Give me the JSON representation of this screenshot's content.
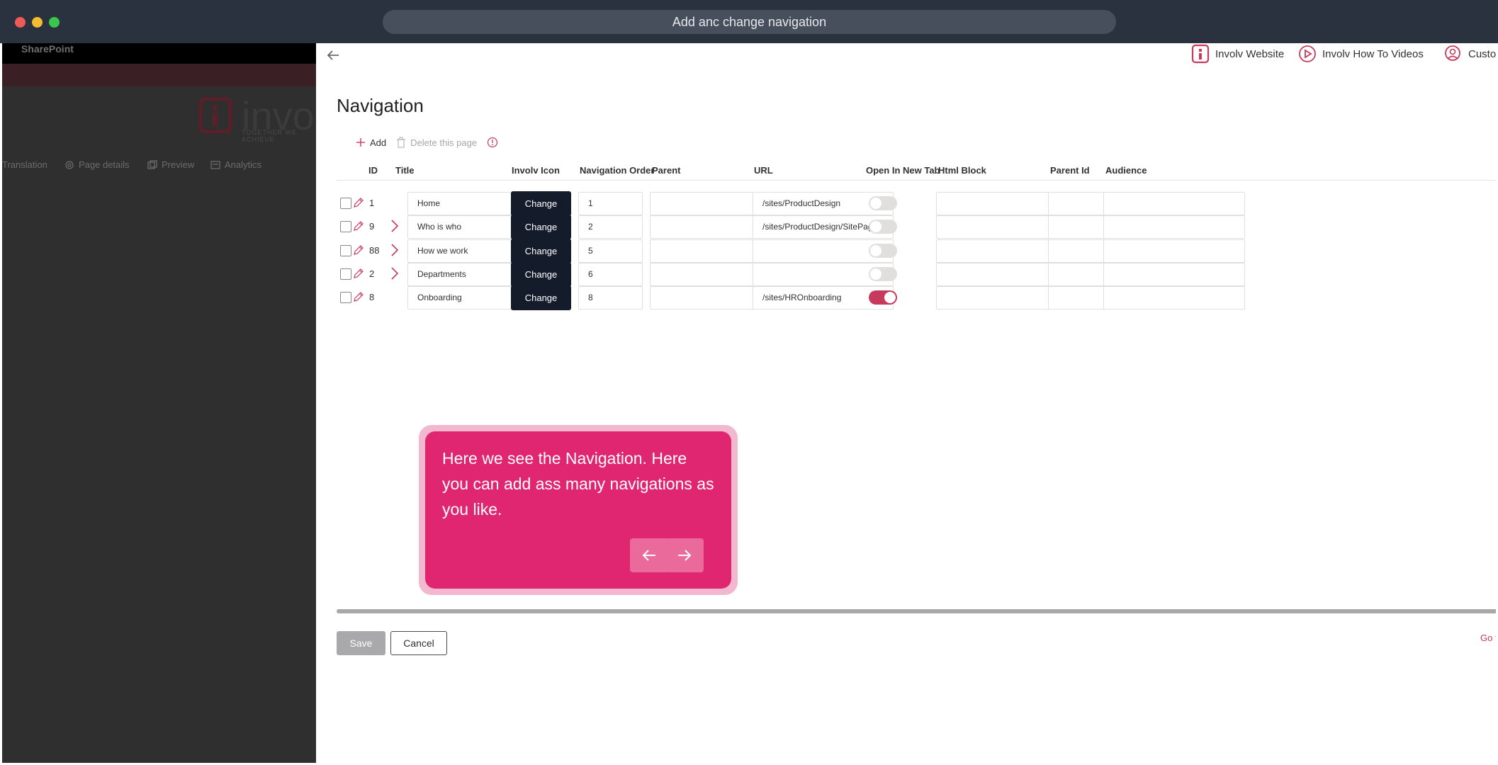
{
  "window": {
    "title": "Add anc change navigation"
  },
  "sharepoint": {
    "brand": "SharePoint",
    "logo_text": "invo",
    "tagline": "TOGETHER WE ACHIEVE",
    "tabs": [
      {
        "label": "Translation"
      },
      {
        "label": "Page details"
      },
      {
        "label": "Preview"
      },
      {
        "label": "Analytics"
      }
    ]
  },
  "header_links": [
    {
      "label": "Involv Website",
      "icon": "involv-logo-icon"
    },
    {
      "label": "Involv How To Videos",
      "icon": "play-circle-icon"
    },
    {
      "label": "Custo",
      "icon": "support-agent-icon"
    }
  ],
  "page": {
    "title": "Navigation"
  },
  "toolbar": {
    "add_label": "Add",
    "delete_label": "Delete this page"
  },
  "table": {
    "columns": {
      "id": "ID",
      "title": "Title",
      "icon": "Involv Icon",
      "order": "Navigation Order",
      "parent": "Parent",
      "url": "URL",
      "new_tab": "Open In New Tab",
      "html": "Html Block",
      "parent_id": "Parent Id",
      "audience": "Audience"
    },
    "change_label": "Change",
    "rows": [
      {
        "id": "1",
        "title": "Home",
        "order": "1",
        "parent": "",
        "url": "/sites/ProductDesign",
        "new_tab": false,
        "has_children": false,
        "has_icon": true
      },
      {
        "id": "9",
        "title": "Who is who",
        "order": "2",
        "parent": "",
        "url": "/sites/ProductDesign/SitePag",
        "new_tab": false,
        "has_children": true,
        "has_icon": false
      },
      {
        "id": "88",
        "title": "How we work",
        "order": "5",
        "parent": "",
        "url": "",
        "new_tab": false,
        "has_children": true,
        "has_icon": false
      },
      {
        "id": "2",
        "title": "Departments",
        "order": "6",
        "parent": "",
        "url": "",
        "new_tab": false,
        "has_children": true,
        "has_icon": false
      },
      {
        "id": "8",
        "title": "Onboarding",
        "order": "8",
        "parent": "",
        "url": "/sites/HROnboarding",
        "new_tab": true,
        "has_children": false,
        "has_icon": false
      }
    ]
  },
  "tour": {
    "text": "Here we see the Navigation. Here you can add ass many navigations as you like."
  },
  "footer": {
    "save_label": "Save",
    "cancel_label": "Cancel",
    "go_label": "Go t"
  },
  "colors": {
    "accent": "#c73a5e",
    "tour_bg": "#e02670",
    "change_btn": "#141c2b",
    "titlebar": "#2a3240"
  }
}
